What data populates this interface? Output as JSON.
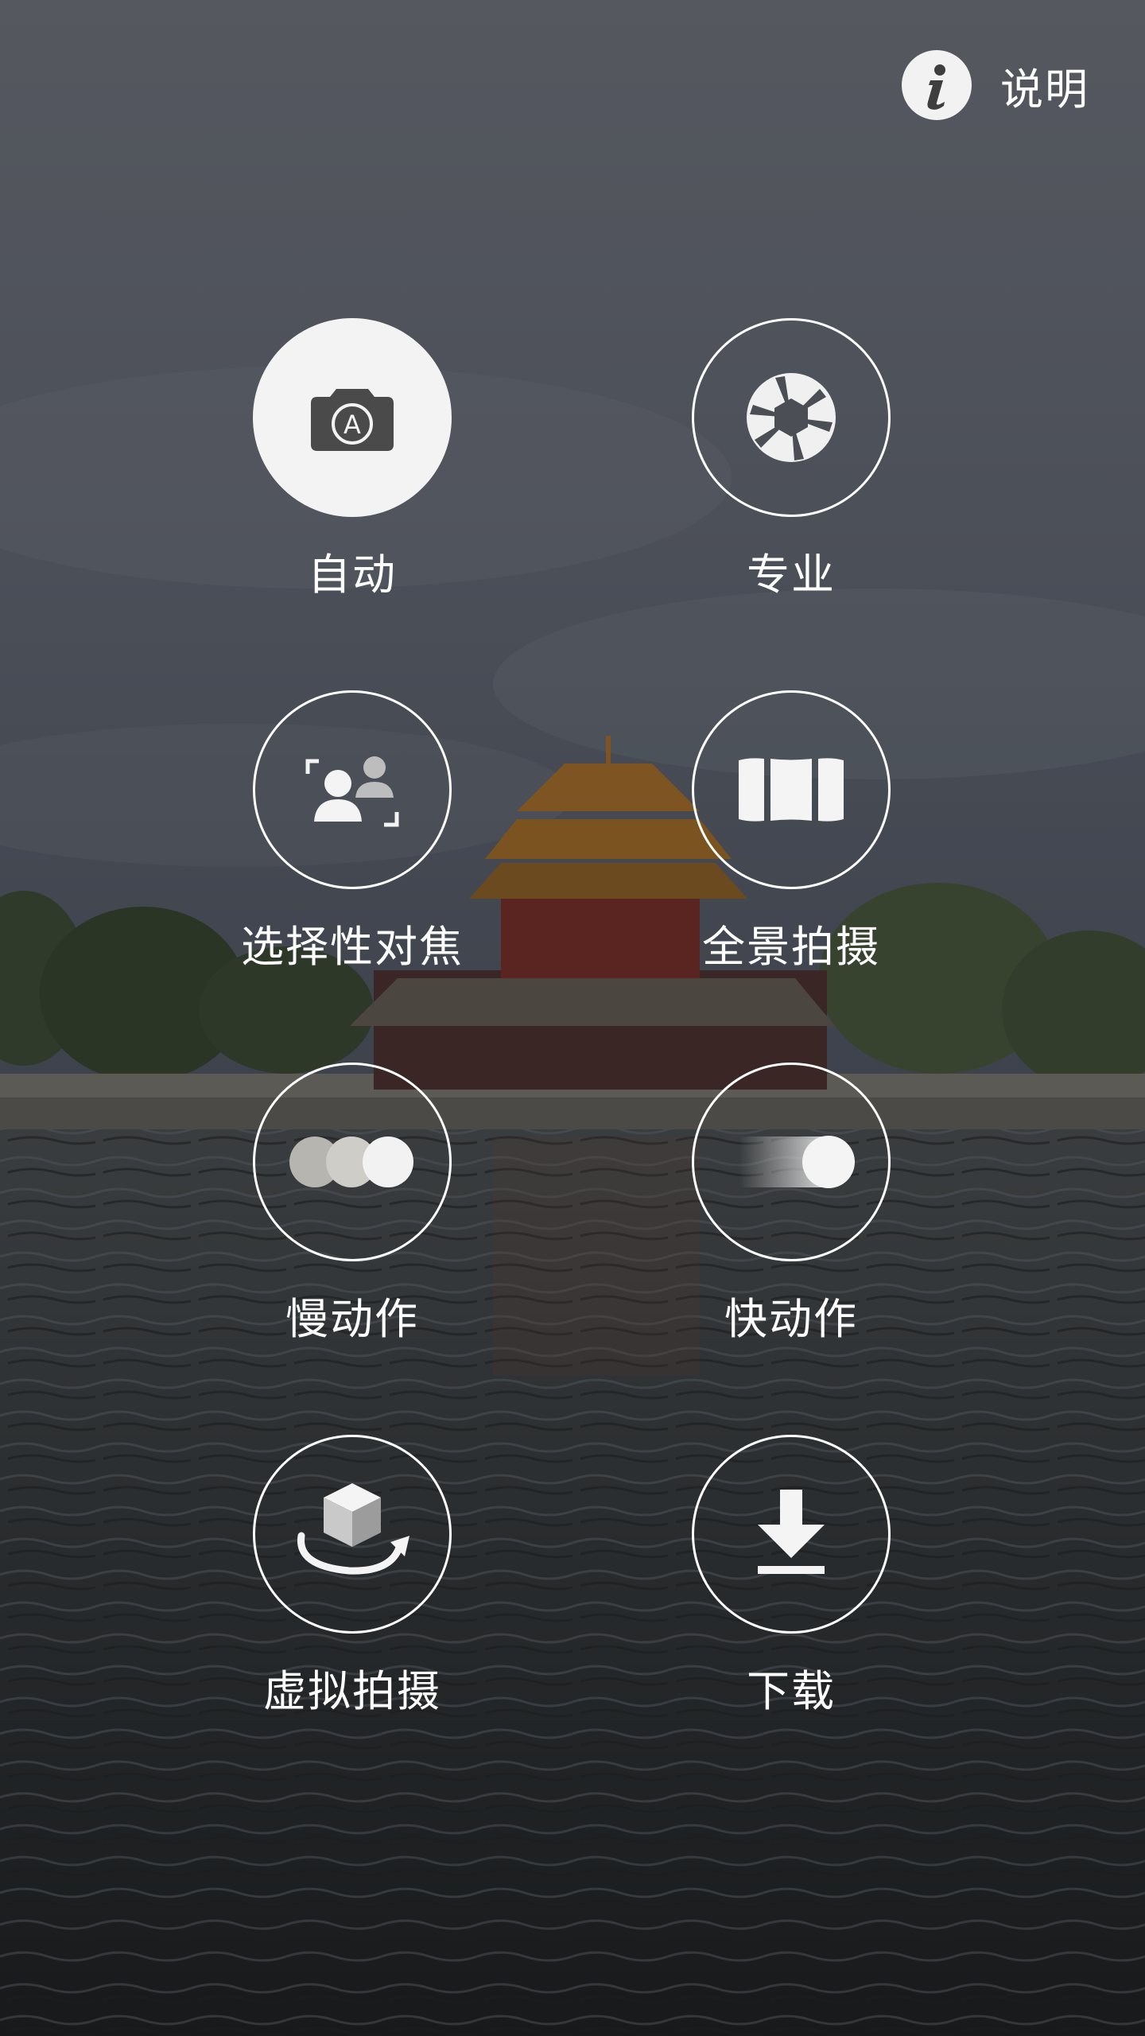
{
  "header": {
    "help_label": "说明",
    "help_icon": "info-icon"
  },
  "modes": [
    {
      "label": "自动",
      "icon": "auto-camera-icon",
      "selected": true
    },
    {
      "label": "专业",
      "icon": "aperture-icon",
      "selected": false
    },
    {
      "label": "选择性对焦",
      "icon": "selective-focus-icon",
      "selected": false
    },
    {
      "label": "全景拍摄",
      "icon": "panorama-icon",
      "selected": false
    },
    {
      "label": "慢动作",
      "icon": "slow-motion-icon",
      "selected": false
    },
    {
      "label": "快动作",
      "icon": "hyperlapse-icon",
      "selected": false
    },
    {
      "label": "虚拟拍摄",
      "icon": "virtual-shot-icon",
      "selected": false
    },
    {
      "label": "下载",
      "icon": "download-icon",
      "selected": false
    }
  ],
  "colors": {
    "overlay_text": "#ffffff",
    "selected_fill": "#f3f3f3",
    "icon_dark": "#4a4a4a"
  }
}
